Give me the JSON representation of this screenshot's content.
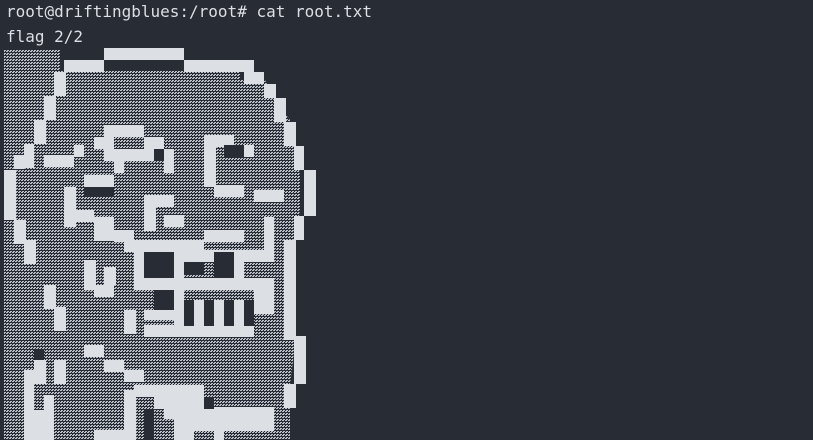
{
  "terminal": {
    "prompt": "root@driftingblues:/root# ",
    "command": "cat root.txt",
    "output_heading": "flag 2/2"
  },
  "art": {
    "description_icon": "ascii-skull-art",
    "colors": {
      "background": "#282c34",
      "solid": "#dcdfe4",
      "shade": "#9aa0a8"
    }
  }
}
